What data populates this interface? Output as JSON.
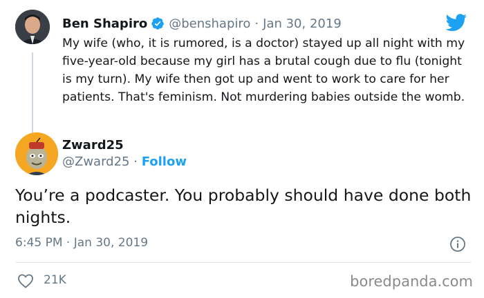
{
  "parent_tweet": {
    "author_name": "Ben Shapiro",
    "handle": "@benshapiro",
    "date": "Jan 30, 2019",
    "separator": "·",
    "text": "My wife (who, it is rumored, is a doctor) stayed up all night with my five-year-old because my girl has a brutal cough due to flu (tonight is my turn). My wife then got up and went to work to care for her patients. That's feminism. Not murdering babies outside the womb."
  },
  "reply": {
    "author_name": "Zward25",
    "handle": "@Zward25",
    "separator": "·",
    "follow_label": "Follow",
    "text": "You’re a podcaster. You probably should have done both nights.",
    "timestamp": "6:45 PM · Jan 30, 2019",
    "like_count": "21K"
  },
  "watermark": "boredpanda.com",
  "colors": {
    "twitter_blue": "#1da1f2",
    "secondary_text": "#657786",
    "primary_text": "#14171a"
  },
  "icons": [
    "twitter-bird-icon",
    "verified-badge-icon",
    "info-icon",
    "heart-icon"
  ]
}
